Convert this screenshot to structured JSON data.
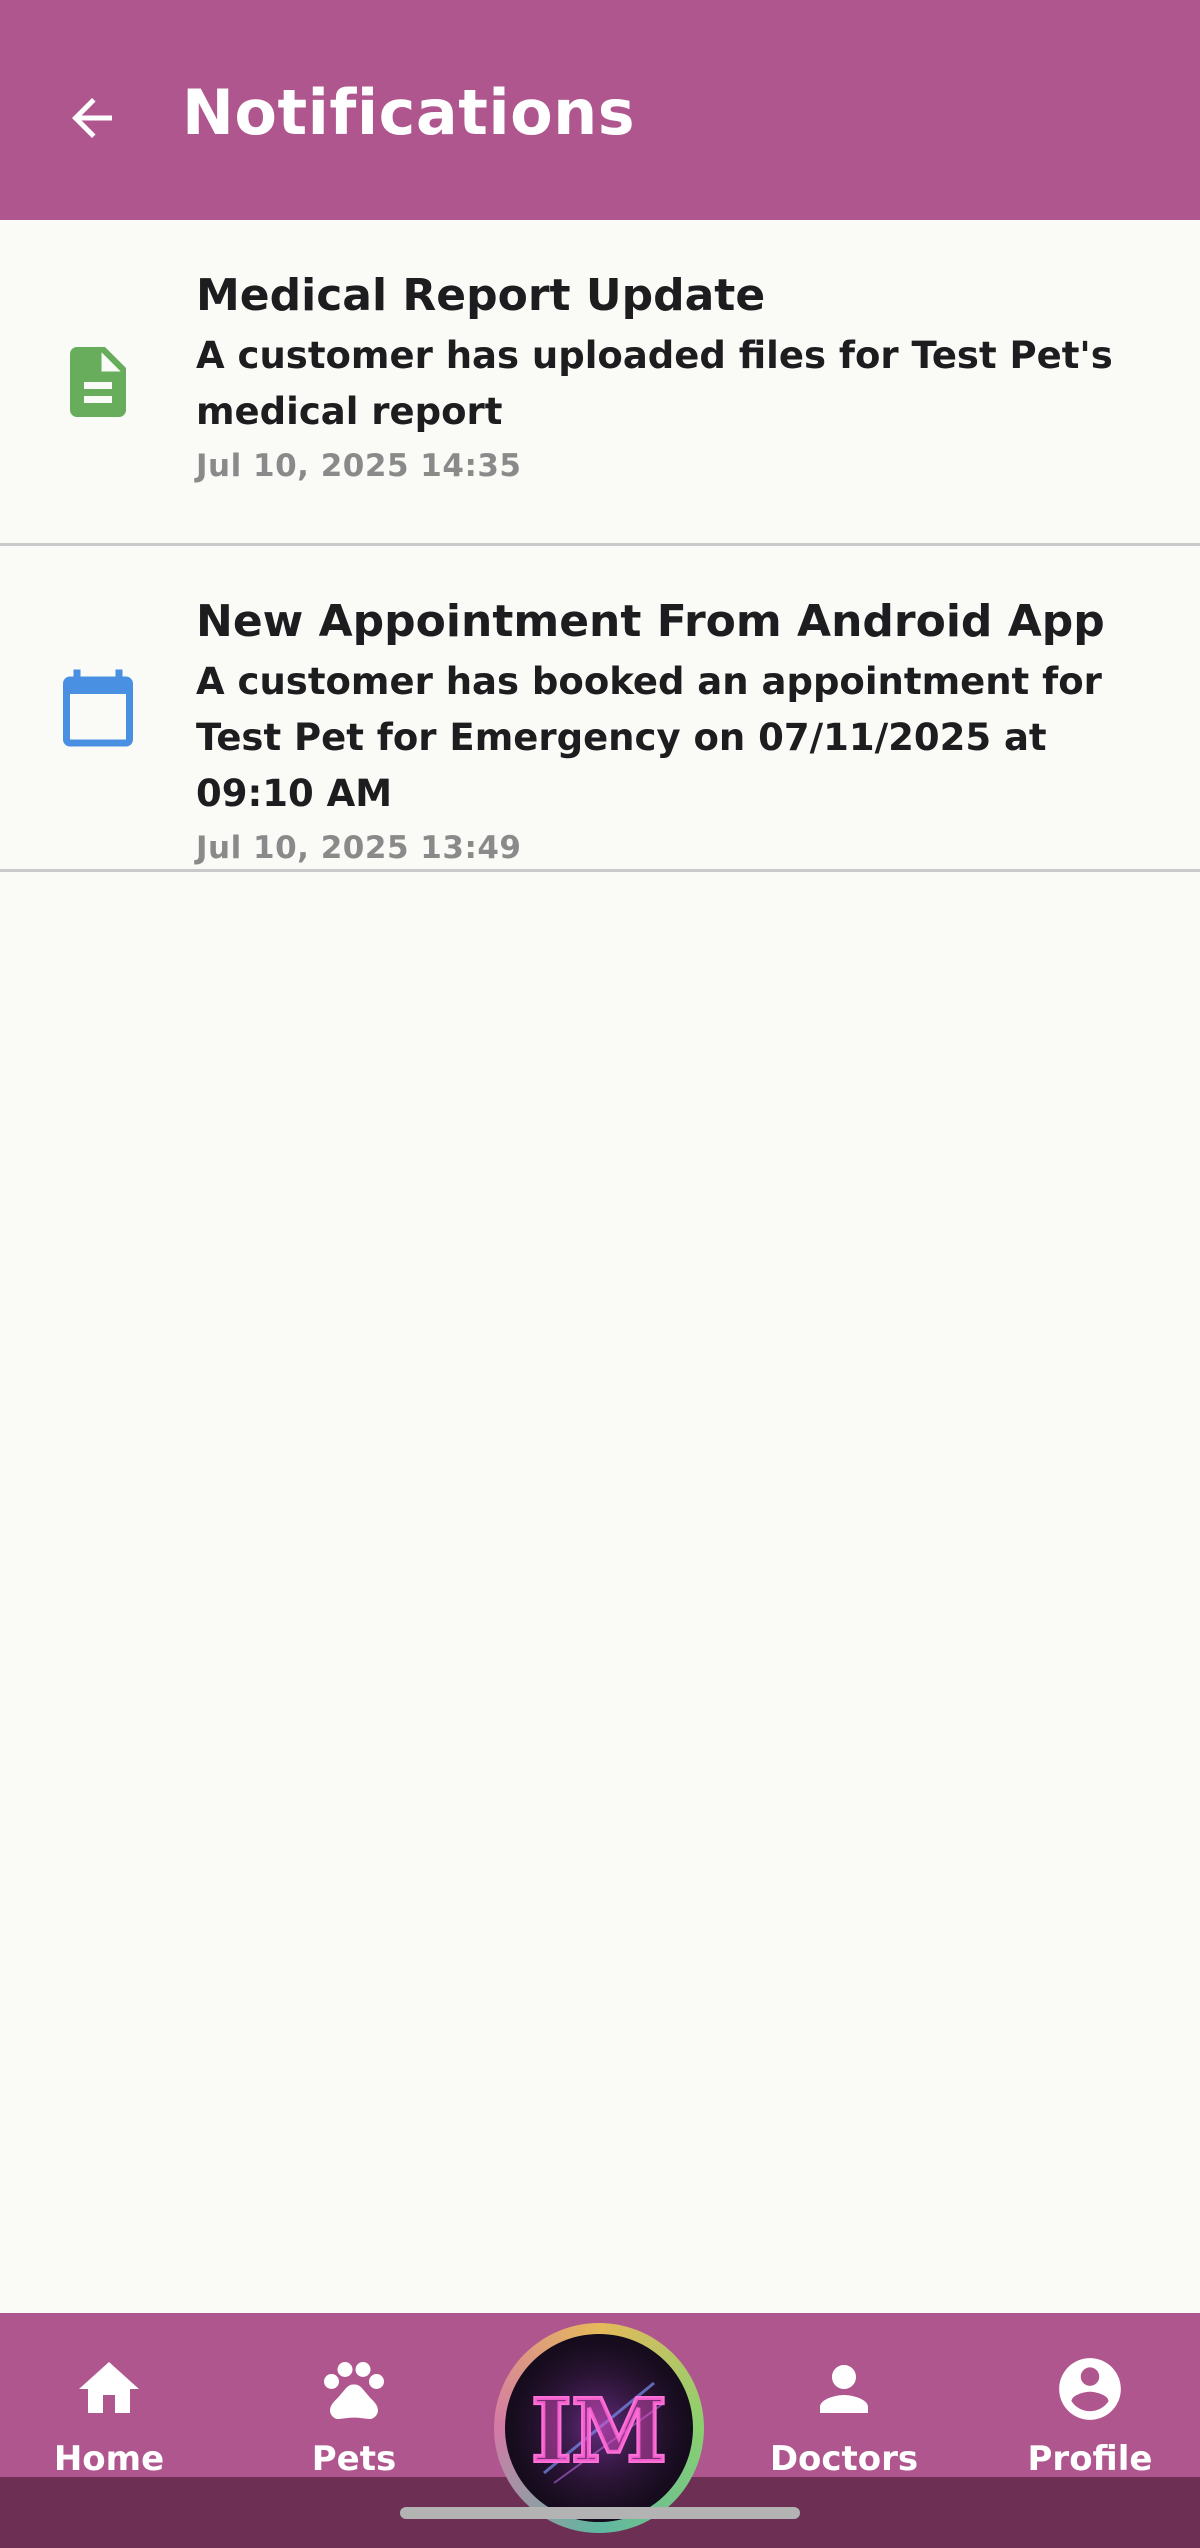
{
  "header": {
    "title": "Notifications",
    "back_icon": "arrow-left-icon"
  },
  "notifications": [
    {
      "icon": "document-icon",
      "icon_color": "#67ad5b",
      "title": "Medical Report Update",
      "body": "A customer has uploaded files for Test Pet's medical report",
      "time": "Jul 10, 2025 14:35"
    },
    {
      "icon": "calendar-icon",
      "icon_color": "#4a90e2",
      "title": "New Appointment From Android App",
      "body": "A customer has booked an appointment for Test Pet for Emergency on 07/11/2025 at 09:10 AM",
      "time": "Jul 10, 2025 13:49"
    }
  ],
  "bottom_nav": {
    "items": [
      {
        "label": "Home",
        "icon": "home-icon"
      },
      {
        "label": "Pets",
        "icon": "paw-icon"
      },
      {
        "label": "Doctors",
        "icon": "person-icon"
      },
      {
        "label": "Profile",
        "icon": "account-circle-icon"
      }
    ],
    "center_logo": "IM"
  },
  "colors": {
    "primary": "#b0568f",
    "background": "#fafbf7",
    "divider": "#c9c9cc"
  }
}
